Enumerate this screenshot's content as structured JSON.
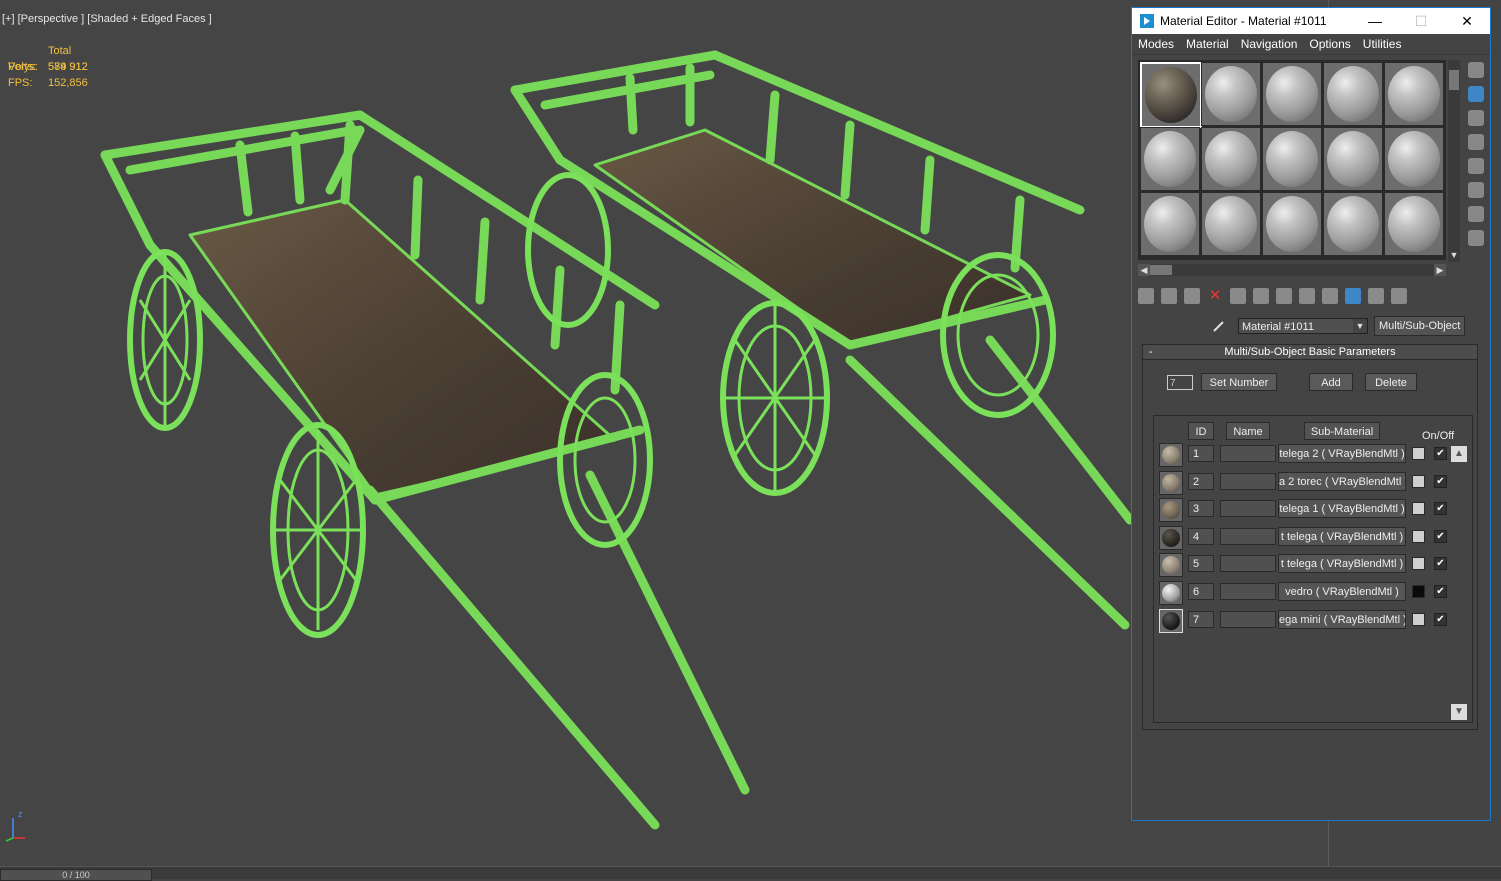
{
  "viewport": {
    "label": "[+] [Perspective ] [Shaded + Edged Faces ]",
    "stats": {
      "header": "Total",
      "polys_label": "Polys:",
      "polys_value": "579 912",
      "verts_label": "Verts:",
      "verts_value": "584 912",
      "fps_label": "FPS:",
      "fps_value": "152,856"
    },
    "axis_z": "z",
    "timeline": "0 / 100"
  },
  "material_editor": {
    "title": "Material Editor - Material #1011",
    "menu": [
      "Modes",
      "Material",
      "Navigation",
      "Options",
      "Utilities"
    ],
    "material_name": "Material #1011",
    "material_type": "Multi/Sub-Object",
    "rollout_title": "Multi/Sub-Object Basic Parameters",
    "rollout_toggle": "-",
    "count_value": "7",
    "set_number_label": "Set Number",
    "add_label": "Add",
    "delete_label": "Delete",
    "columns": {
      "id": "ID",
      "name": "Name",
      "sub_material": "Sub-Material",
      "on_off": "On/Off"
    },
    "rows": [
      {
        "id": "1",
        "sub": "telega 2  ( VRayBlendMtl )",
        "swatch": "#cfcfcf",
        "ball": "#8a8070",
        "on": "✔"
      },
      {
        "id": "2",
        "sub": "a 2 torec  ( VRayBlendMtl )",
        "swatch": "#cfcfcf",
        "ball": "#857a6a",
        "on": "✔"
      },
      {
        "id": "3",
        "sub": "telega 1  ( VRayBlendMtl )",
        "swatch": "#cfcfcf",
        "ball": "#6e6252",
        "on": "✔"
      },
      {
        "id": "4",
        "sub": "t telega  ( VRayBlendMtl )",
        "swatch": "#cfcfcf",
        "ball": "#2a2722",
        "on": "✔"
      },
      {
        "id": "5",
        "sub": "t telega  ( VRayBlendMtl )",
        "swatch": "#cfcfcf",
        "ball": "#8e8474",
        "on": "✔"
      },
      {
        "id": "6",
        "sub": "vedro  ( VRayBlendMtl )",
        "swatch": "#0a0a0a",
        "ball": "#a8a8a8",
        "on": "✔"
      },
      {
        "id": "7",
        "sub": "ega mini  ( VRayBlendMtl )",
        "swatch": "#cfcfcf",
        "ball": "#1e1e1e",
        "on": "✔"
      }
    ],
    "colors": {
      "title_accent": "#1b8fd1",
      "wire": "#7be05a",
      "stats": "#f0c040"
    }
  }
}
